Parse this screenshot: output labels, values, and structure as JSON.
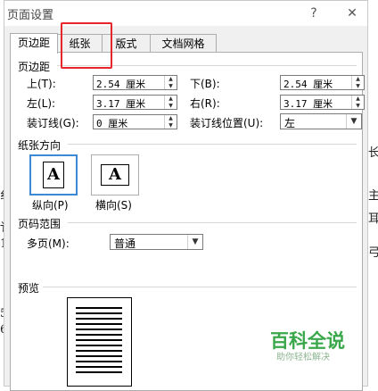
{
  "dialog": {
    "title": "页面设置",
    "help_symbol": "?",
    "close_symbol": "✕"
  },
  "tabs": [
    {
      "label": "页边距",
      "active": true
    },
    {
      "label": "纸张",
      "active": false
    },
    {
      "label": "版式",
      "active": false
    },
    {
      "label": "文档网格",
      "active": false
    }
  ],
  "margins": {
    "section_label": "页边距",
    "top_label": "上(T):",
    "top_value": "2.54 厘米",
    "bottom_label": "下(B):",
    "bottom_value": "2.54 厘米",
    "left_label": "左(L):",
    "left_value": "3.17 厘米",
    "right_label": "右(R):",
    "right_value": "3.17 厘米",
    "gutter_label": "装订线(G):",
    "gutter_value": "0 厘米",
    "gutter_pos_label": "装订线位置(U):",
    "gutter_pos_value": "左"
  },
  "orientation": {
    "section_label": "纸张方向",
    "portrait_label": "纵向(P)",
    "landscape_label": "横向(S)",
    "icon_letter": "A"
  },
  "pages": {
    "section_label": "页码范围",
    "multiple_label": "多页(M):",
    "multiple_value": "普通"
  },
  "preview": {
    "section_label": "预览"
  },
  "watermark": {
    "title": "百科全说",
    "subtitle": "助你轻松解决"
  },
  "background_glyphs": [
    "纟",
    "讠",
    "1",
    "5",
    "6",
    "长",
    "主",
    "耳",
    "弓"
  ]
}
